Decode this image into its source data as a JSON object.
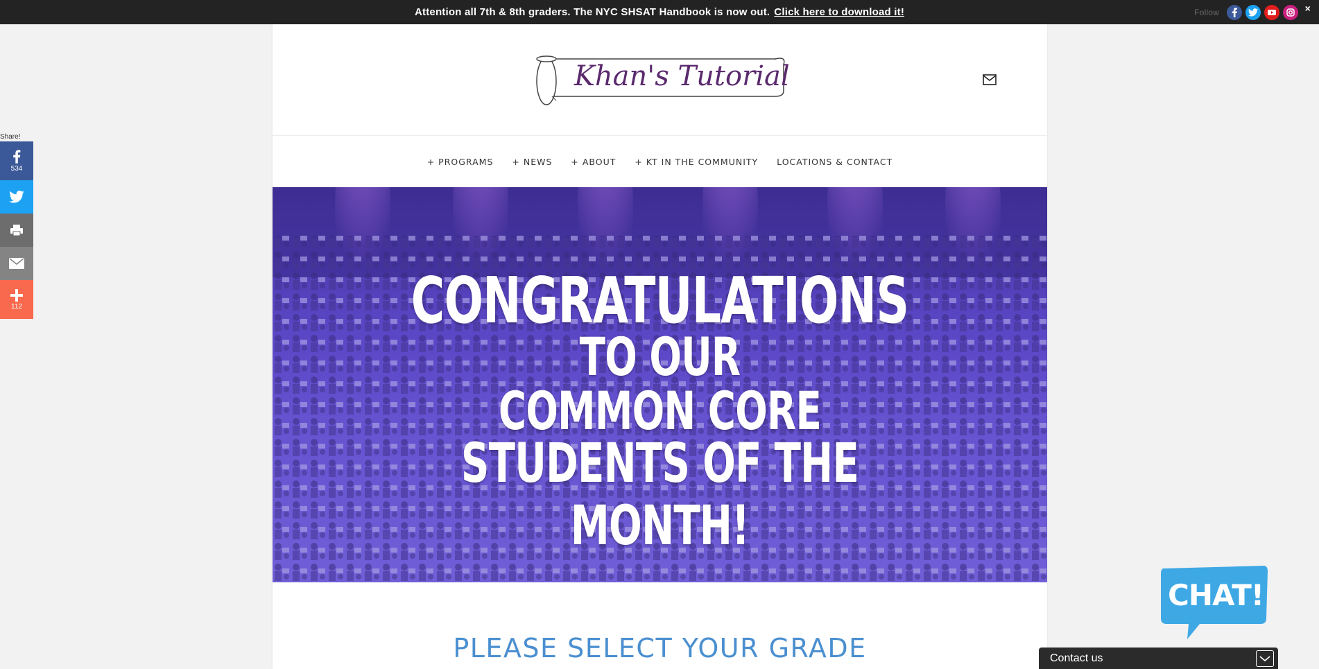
{
  "topbar": {
    "message": "Attention all 7th & 8th graders. The NYC SHSAT Handbook is now out.",
    "link": "Click here to download it!",
    "follow_label": "Follow",
    "close": "×",
    "social": [
      "facebook-icon",
      "twitter-icon",
      "youtube-icon",
      "instagram-icon"
    ]
  },
  "header": {
    "logo_text": "Khan's Tutorial"
  },
  "nav": {
    "items": [
      "+ PROGRAMS",
      "+ NEWS",
      "+ ABOUT",
      "+ KT IN THE COMMUNITY",
      "LOCATIONS & CONTACT"
    ]
  },
  "hero": {
    "line1": "CONGRATULATIONS",
    "line2": "TO OUR",
    "line3": "COMMON CORE",
    "line4": "STUDENTS OF THE MONTH!"
  },
  "grade": {
    "title": "PLEASE SELECT YOUR GRADE"
  },
  "share": {
    "label": "Share!",
    "facebook_count": "534",
    "more_count": "112"
  },
  "chat": {
    "bubble": "CHAT!",
    "contact_label": "Contact us"
  },
  "colors": {
    "facebook": "#3b5998",
    "twitter": "#1da1f2",
    "print": "#6d6d6d",
    "email": "#848484",
    "more": "#f8694d",
    "grade_title": "#4a8fd0",
    "hero_overlay": "#5a46c5",
    "logo_text": "#5b2a6e"
  }
}
